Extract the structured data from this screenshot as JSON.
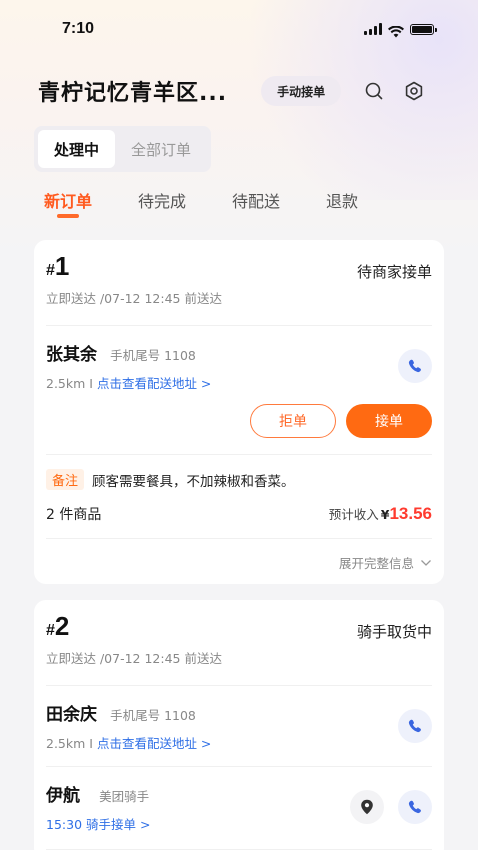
{
  "status_bar": {
    "time": "7:10"
  },
  "header": {
    "store_name": "青柠记忆青羊区...",
    "manual_button": "手动接单",
    "search_icon": "search-icon",
    "settings_icon": "gear-icon"
  },
  "segment": {
    "processing": "处理中",
    "all_orders": "全部订单",
    "selected": "处理中"
  },
  "tabs": [
    {
      "label": "新订单",
      "active": true
    },
    {
      "label": "待完成",
      "active": false
    },
    {
      "label": "待配送",
      "active": false
    },
    {
      "label": "退款",
      "active": false
    }
  ],
  "orders": [
    {
      "hash": "#",
      "number": "1",
      "status": "待商家接单",
      "delivery": "立即送达 /07-12  12:45 前送达",
      "customer": {
        "name": "张其余",
        "phone": "手机尾号 1108",
        "distance": "2.5km",
        "separator": " I ",
        "address_link": "点击查看配送地址 >"
      },
      "reject_label": "拒单",
      "accept_label": "接单",
      "note_tag": "备注",
      "note_text": "顾客需要餐具，不加辣椒和香菜。",
      "goods_count": "2 件商品",
      "income_label": "预计收入",
      "income_currency": "¥",
      "income_amount": "13.56",
      "expand_label": "展开完整信息"
    },
    {
      "hash": "#",
      "number": "2",
      "status": "骑手取货中",
      "delivery": "立即送达 /07-12  12:45 前送达",
      "customer": {
        "name": "田余庆",
        "phone": "手机尾号 1108",
        "distance": "2.5km",
        "separator": " I ",
        "address_link": "点击查看配送地址 >"
      },
      "rider": {
        "name": "伊航",
        "role": "美团骑手",
        "pickup": "15:30 骑手接单 >"
      }
    }
  ],
  "colors": {
    "accent": "#ff6a12",
    "link": "#2f6fe6",
    "price": "#ff3b2f"
  }
}
